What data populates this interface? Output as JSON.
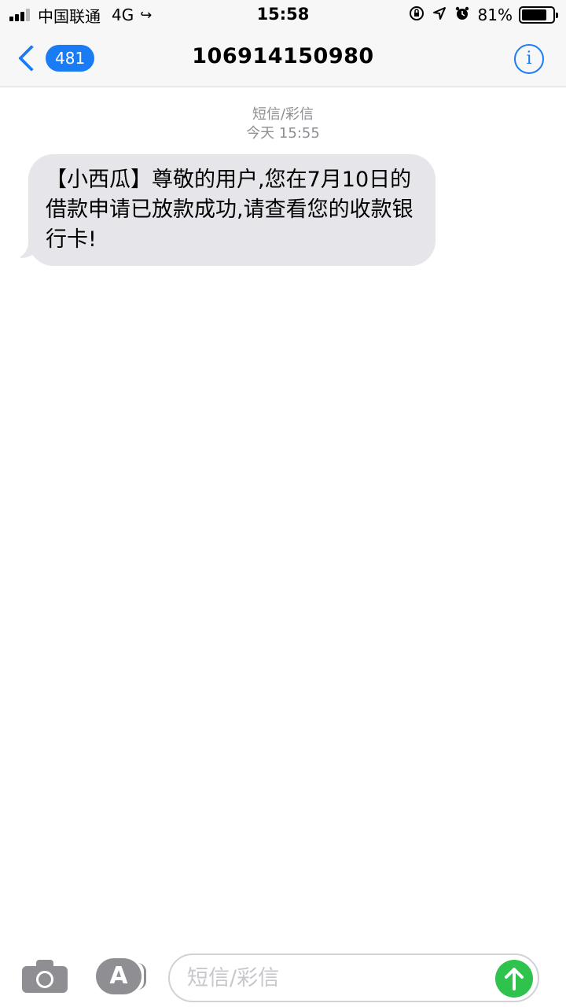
{
  "status_bar": {
    "carrier": "中国联通",
    "network": "4G",
    "time": "15:58",
    "battery_percent": "81%",
    "battery_level": 0.81,
    "icons": [
      "signal-icon",
      "phone-call-icon",
      "orientation-lock-icon",
      "location-icon",
      "alarm-icon",
      "battery-icon"
    ]
  },
  "nav": {
    "back_badge": "481",
    "title": "106914150980",
    "info_label": "i"
  },
  "thread": {
    "message_type": "短信/彩信",
    "timestamp": "今天 15:55",
    "messages": [
      {
        "direction": "incoming",
        "text": "【小西瓜】尊敬的用户,您在7月10日的借款申请已放款成功,请查看您的收款银行卡!"
      }
    ]
  },
  "composer": {
    "placeholder": "短信/彩信",
    "value": "",
    "appstore_label": "A"
  },
  "colors": {
    "accent": "#1a7cf5",
    "bubble_incoming": "#e5e5ea",
    "send": "#2fc24d",
    "secondary_text": "#8e8e93"
  }
}
